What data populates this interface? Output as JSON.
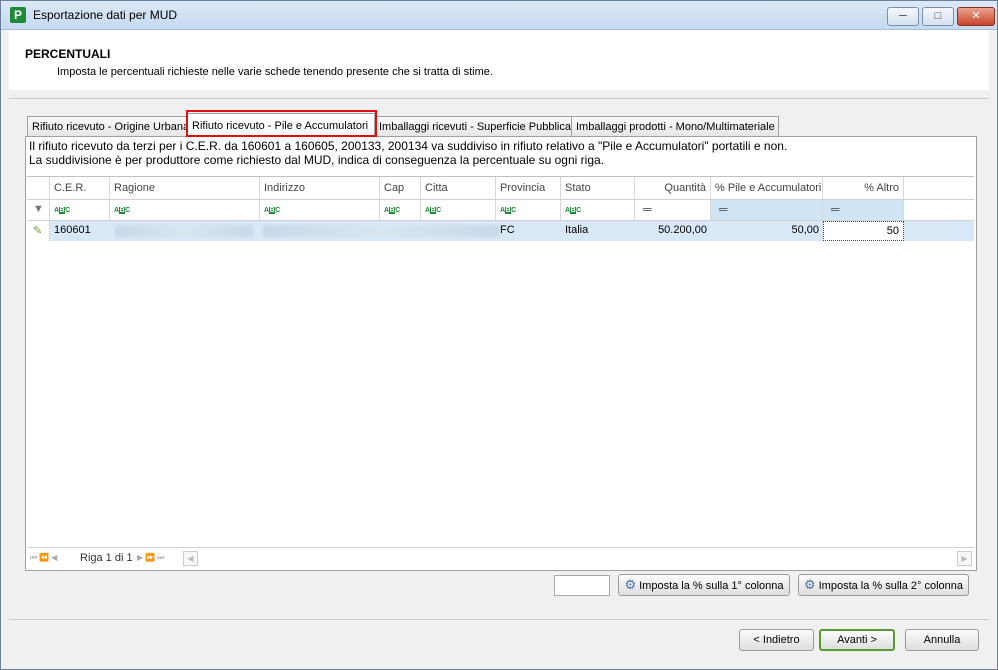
{
  "window": {
    "title": "Esportazione dati per MUD",
    "icon": "app-logo-icon"
  },
  "header": {
    "title": "PERCENTUALI",
    "subtitle": "Imposta le percentuali richieste nelle varie schede tenendo presente che si tratta di stime."
  },
  "tabs": [
    {
      "label": "Rifiuto ricevuto - Origine Urbana",
      "active": false
    },
    {
      "label": "Rifiuto ricevuto - Pile e Accumulatori",
      "active": true
    },
    {
      "label": "Imballaggi ricevuti - Superficie Pubblica",
      "active": false
    },
    {
      "label": "Imballaggi prodotti - Mono/Multimateriale",
      "active": false
    }
  ],
  "description": {
    "line1": "Il rifiuto ricevuto da terzi per i C.E.R. da 160601 a 160605, 200133, 200134 va suddiviso in rifiuto relativo a \"Pile e Accumulatori\" portatili e non.",
    "line2": "La suddivisione è per produttore come richiesto dal MUD, indica di conseguenza la percentuale su ogni riga."
  },
  "grid": {
    "columns": [
      "C.E.R.",
      "Ragione",
      "Indirizzo",
      "Cap",
      "Citta",
      "Provincia",
      "Stato",
      "Quantità",
      "% Pile e Accumulatori",
      "% Altro"
    ],
    "rows": [
      {
        "cer": "160601",
        "ragione": "",
        "indirizzo": "",
        "cap": "",
        "citta": "",
        "provincia": "FC",
        "stato": "Italia",
        "quantita": "50.200,00",
        "pile": "50,00",
        "altro": "50"
      }
    ],
    "pager": "Riga 1 di 1"
  },
  "actions": {
    "set_col1": "Imposta la % sulla 1° colonna",
    "set_col2": "Imposta la % sulla 2° colonna",
    "back": "< Indietro",
    "next": "Avanti >",
    "cancel": "Annulla"
  },
  "colors": {
    "accent": "#d8e8f7",
    "highlight": "#e01010",
    "brand": "#1f8a3a"
  }
}
